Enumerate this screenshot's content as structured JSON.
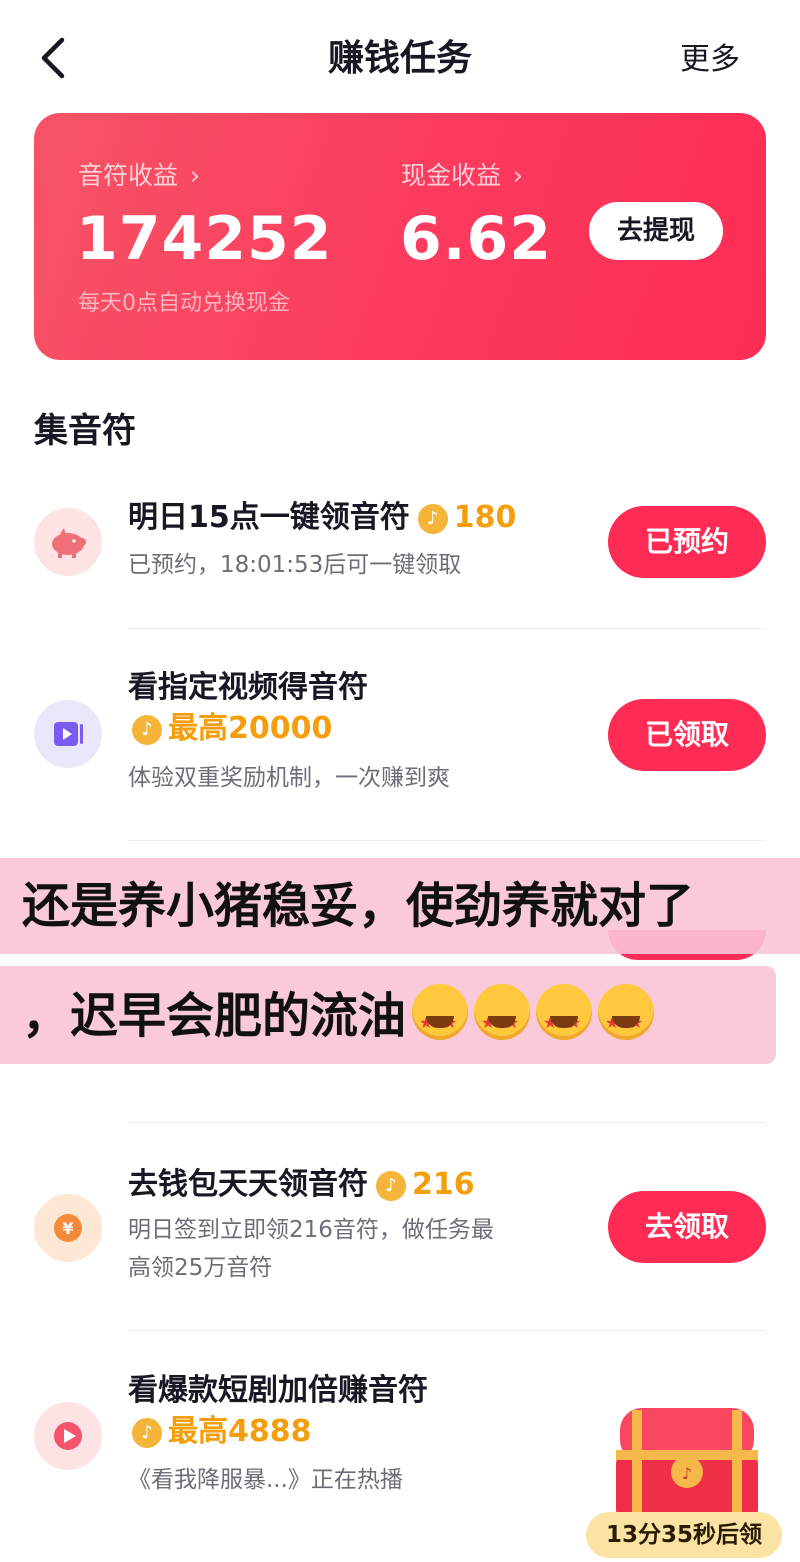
{
  "header": {
    "title": "赚钱任务",
    "more_label": "更多"
  },
  "earnings": {
    "notes_label": "音符收益",
    "notes_value": "174252",
    "cash_label": "现金收益",
    "cash_value": "6.62",
    "withdraw_label": "去提现",
    "note": "每天0点自动兑换现金",
    "accent_color": "#fe2c55"
  },
  "section": {
    "title": "集音符"
  },
  "tasks": [
    {
      "icon": "piggy-bank-icon",
      "title": "明日15点一键领音符",
      "reward": "180",
      "desc": "已预约，18:01:53后可一键领取",
      "button": "已预约"
    },
    {
      "icon": "video-play-icon",
      "title": "看指定视频得音符",
      "reward": "最高20000",
      "desc": "体验双重奖励机制，一次赚到爽",
      "button": "已领取"
    },
    {
      "icon": "yen-coin-icon",
      "title": "去钱包天天领音符",
      "reward": "216",
      "desc_line1": "明日签到立即领216音符，做任务最",
      "desc_line2": "高领25万音符",
      "button": "去领取"
    },
    {
      "icon": "short-drama-play-icon",
      "title": "看爆款短剧加倍赚音符",
      "reward": "最高4888",
      "desc": "《看我降服暴...》正在热播",
      "timer": "13分35秒后领"
    }
  ],
  "overlay": {
    "line1": "还是养小猪稳妥，使劲养就对了",
    "line2": "，迟早会肥的流油"
  }
}
